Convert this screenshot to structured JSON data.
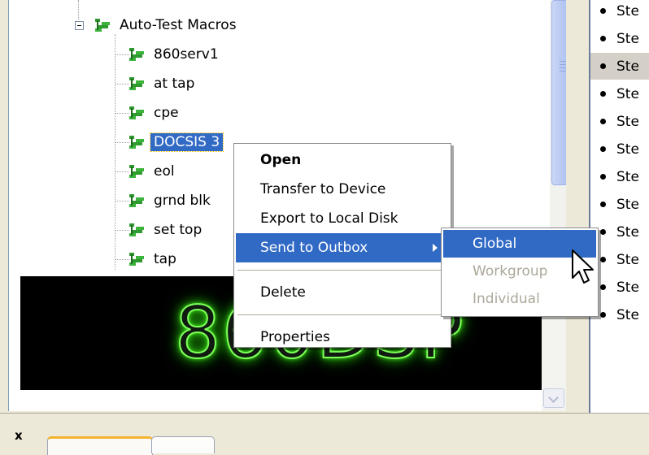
{
  "tree": {
    "folder_label": "Auto-Test Macros",
    "items": [
      {
        "label": "860serv1"
      },
      {
        "label": "at tap"
      },
      {
        "label": "cpe"
      },
      {
        "label": "DOCSIS 3",
        "selected": true
      },
      {
        "label": "eol"
      },
      {
        "label": "grnd blk"
      },
      {
        "label": "set top"
      },
      {
        "label": "tap"
      }
    ],
    "icon": "macro-tree-icon"
  },
  "display": {
    "text": "860DSP",
    "glow_color": "#7dff5a"
  },
  "right_list": {
    "items": [
      "Ste",
      "Ste",
      "Ste",
      "Ste",
      "Ste",
      "Ste",
      "Ste",
      "Ste",
      "Ste",
      "Ste",
      "Ste",
      "Ste"
    ],
    "highlighted_index": 2
  },
  "context_menu": {
    "items": [
      {
        "label": "Open",
        "default": true
      },
      {
        "label": "Transfer to Device"
      },
      {
        "label": "Export to Local Disk"
      },
      {
        "label": "Send to Outbox",
        "has_submenu": true,
        "hover": true
      },
      {
        "label": "Delete"
      },
      {
        "label": "Properties"
      }
    ],
    "submenu": [
      {
        "label": "Global",
        "hover": true
      },
      {
        "label": "Workgroup",
        "disabled": true
      },
      {
        "label": "Individual",
        "disabled": true
      }
    ]
  },
  "bottom": {
    "close_label": "x"
  },
  "colors": {
    "selection": "#316ac5",
    "window_bg": "#ece9d8"
  }
}
